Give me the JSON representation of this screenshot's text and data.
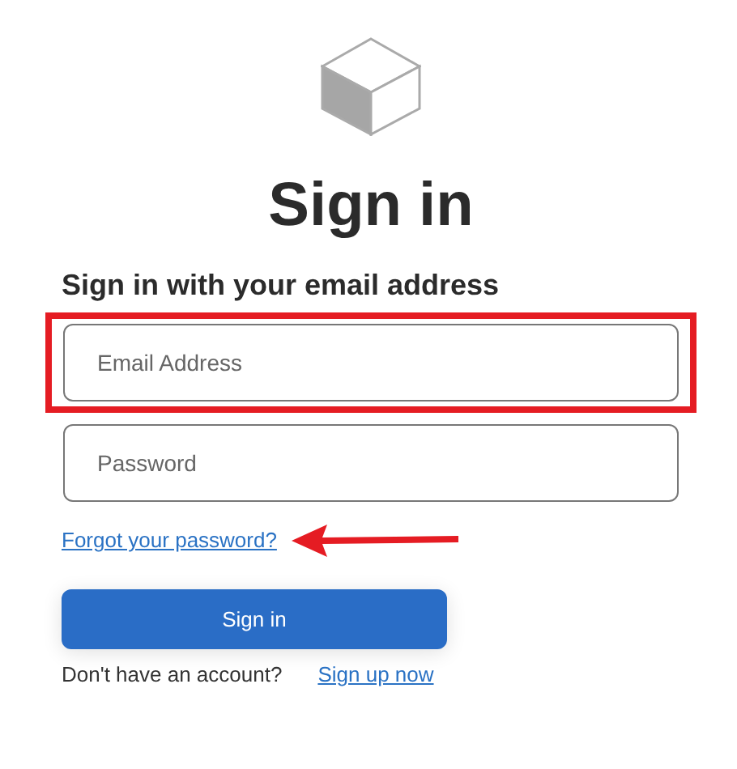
{
  "title": "Sign in",
  "subtitle": "Sign in with your email address",
  "fields": [
    {
      "placeholder": "Email Address",
      "highlighted": true
    },
    {
      "placeholder": "Password",
      "highlighted": false
    }
  ],
  "forgot_link": {
    "label": "Forgot your password?",
    "arrow": true
  },
  "submit_button": "Sign in",
  "signup": {
    "prompt": "Don't have an account?",
    "link": "Sign up now"
  }
}
